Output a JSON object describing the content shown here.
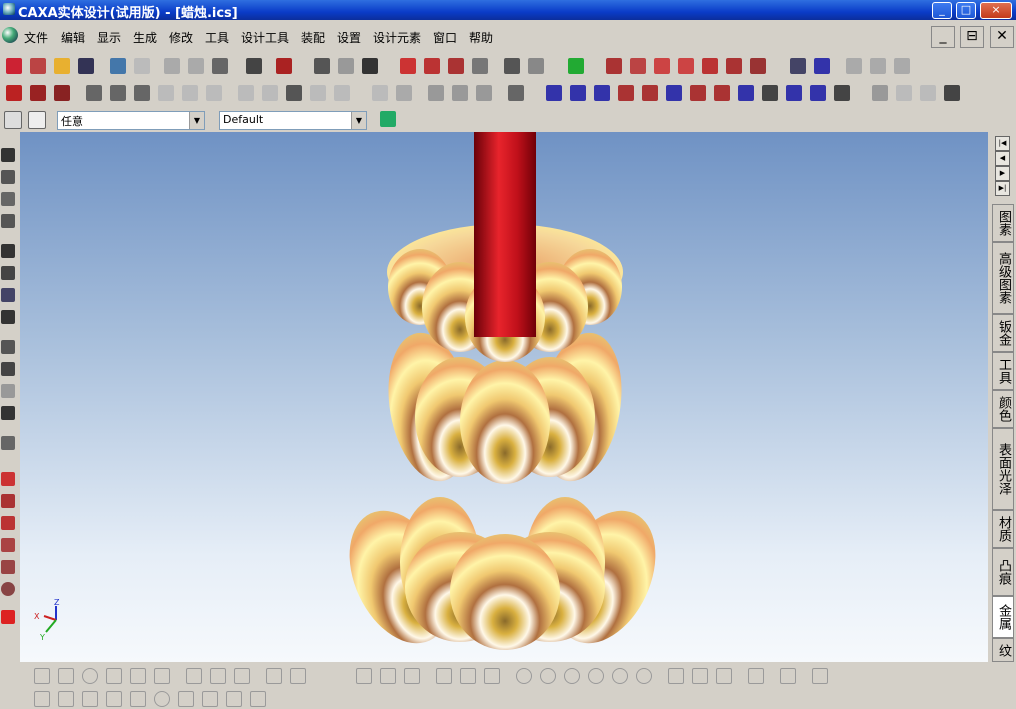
{
  "window": {
    "title": "CAXA实体设计(试用版) - [蜡烛.ics]",
    "minimize": "_",
    "maximize": "□",
    "close": "×"
  },
  "menu": {
    "items": [
      "文件",
      "编辑",
      "显示",
      "生成",
      "修改",
      "工具",
      "设计工具",
      "装配",
      "设置",
      "设计元素",
      "窗口",
      "帮助"
    ],
    "restore": "⊟",
    "close": "✕",
    "minimize": "_"
  },
  "selectors": {
    "filter": "任意",
    "configuration": "Default"
  },
  "right_panel": {
    "tabs": [
      "图素",
      "高级图素",
      "钣金",
      "工具",
      "颜色",
      "表面光泽",
      "材质",
      "凸痕",
      "金属",
      "纹"
    ],
    "active_tab": "金属"
  },
  "axes": {
    "x": "X",
    "y": "Y",
    "z": "Z"
  },
  "colors": {
    "rod": "#d0141a",
    "accent": "#0a3cc8",
    "viewport_top": "#6f92c4"
  }
}
